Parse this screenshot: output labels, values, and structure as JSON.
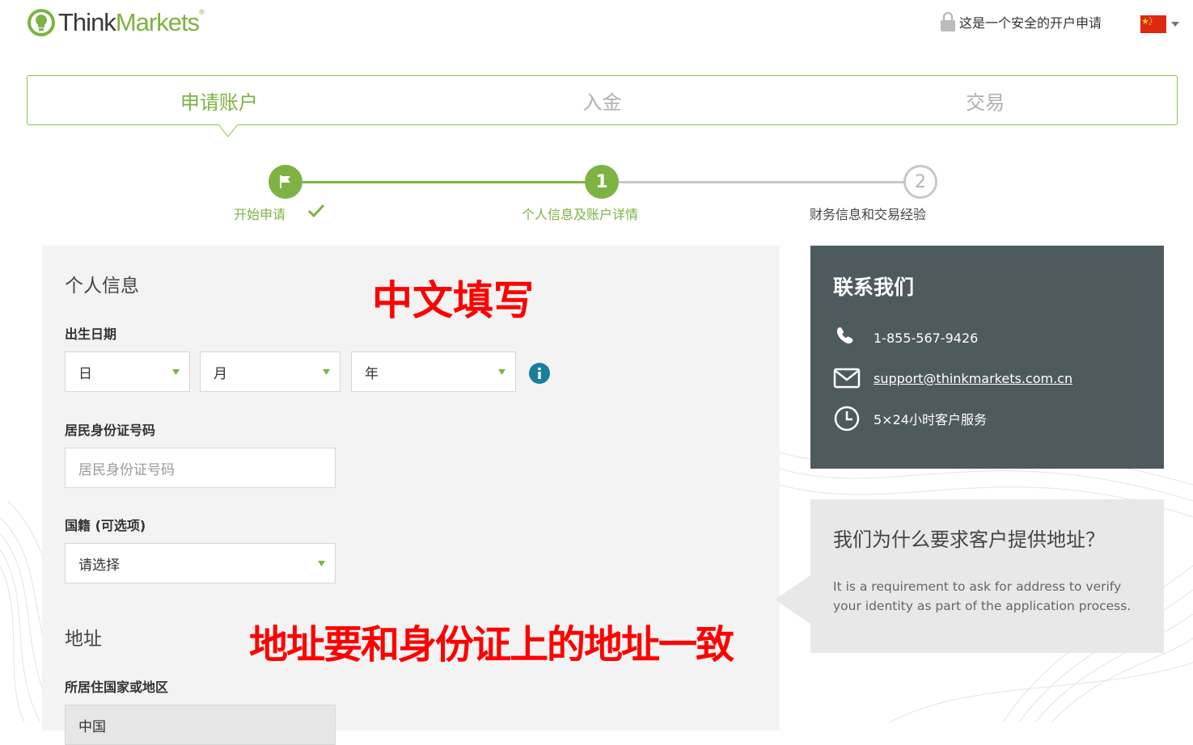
{
  "header": {
    "brand_think": "Think",
    "brand_markets": "Markets",
    "brand_reg": "®",
    "secure_text": "这是一个安全的开户申请",
    "flag": "china-flag"
  },
  "tabs": [
    {
      "label": "申请账户",
      "active": true
    },
    {
      "label": "入金",
      "active": false
    },
    {
      "label": "交易",
      "active": false
    }
  ],
  "stepper": {
    "steps": [
      {
        "label": "开始申请",
        "state": "done"
      },
      {
        "label": "个人信息及账户详情",
        "number": "1",
        "state": "current"
      },
      {
        "label": "财务信息和交易经验",
        "number": "2",
        "state": "pending"
      }
    ]
  },
  "form": {
    "personal_title": "个人信息",
    "annotation_top": "中文填写",
    "dob_label": "出生日期",
    "dob_day": "日",
    "dob_month": "月",
    "dob_year": "年",
    "id_label": "居民身份证号码",
    "id_placeholder": "居民身份证号码",
    "nationality_label": "国籍 (可选项)",
    "nationality_value": "请选择",
    "address_title": "地址",
    "annotation_address": "地址要和身份证上的地址一致",
    "country_label": "所居住国家或地区",
    "country_value": "中国"
  },
  "contact": {
    "title": "联系我们",
    "phone": "1-855-567-9426",
    "email": "support@thinkmarkets.com.cn",
    "hours": "5×24小时客户服务"
  },
  "why": {
    "title": "我们为什么要求客户提供地址？",
    "text": "It is a requirement to ask for address to verify your identity as part of the application process."
  },
  "colors": {
    "brand_green": "#7cb342",
    "contact_bg": "#4d5a5e",
    "annotation_red": "#ff0000",
    "info_blue": "#1a7f9c"
  }
}
